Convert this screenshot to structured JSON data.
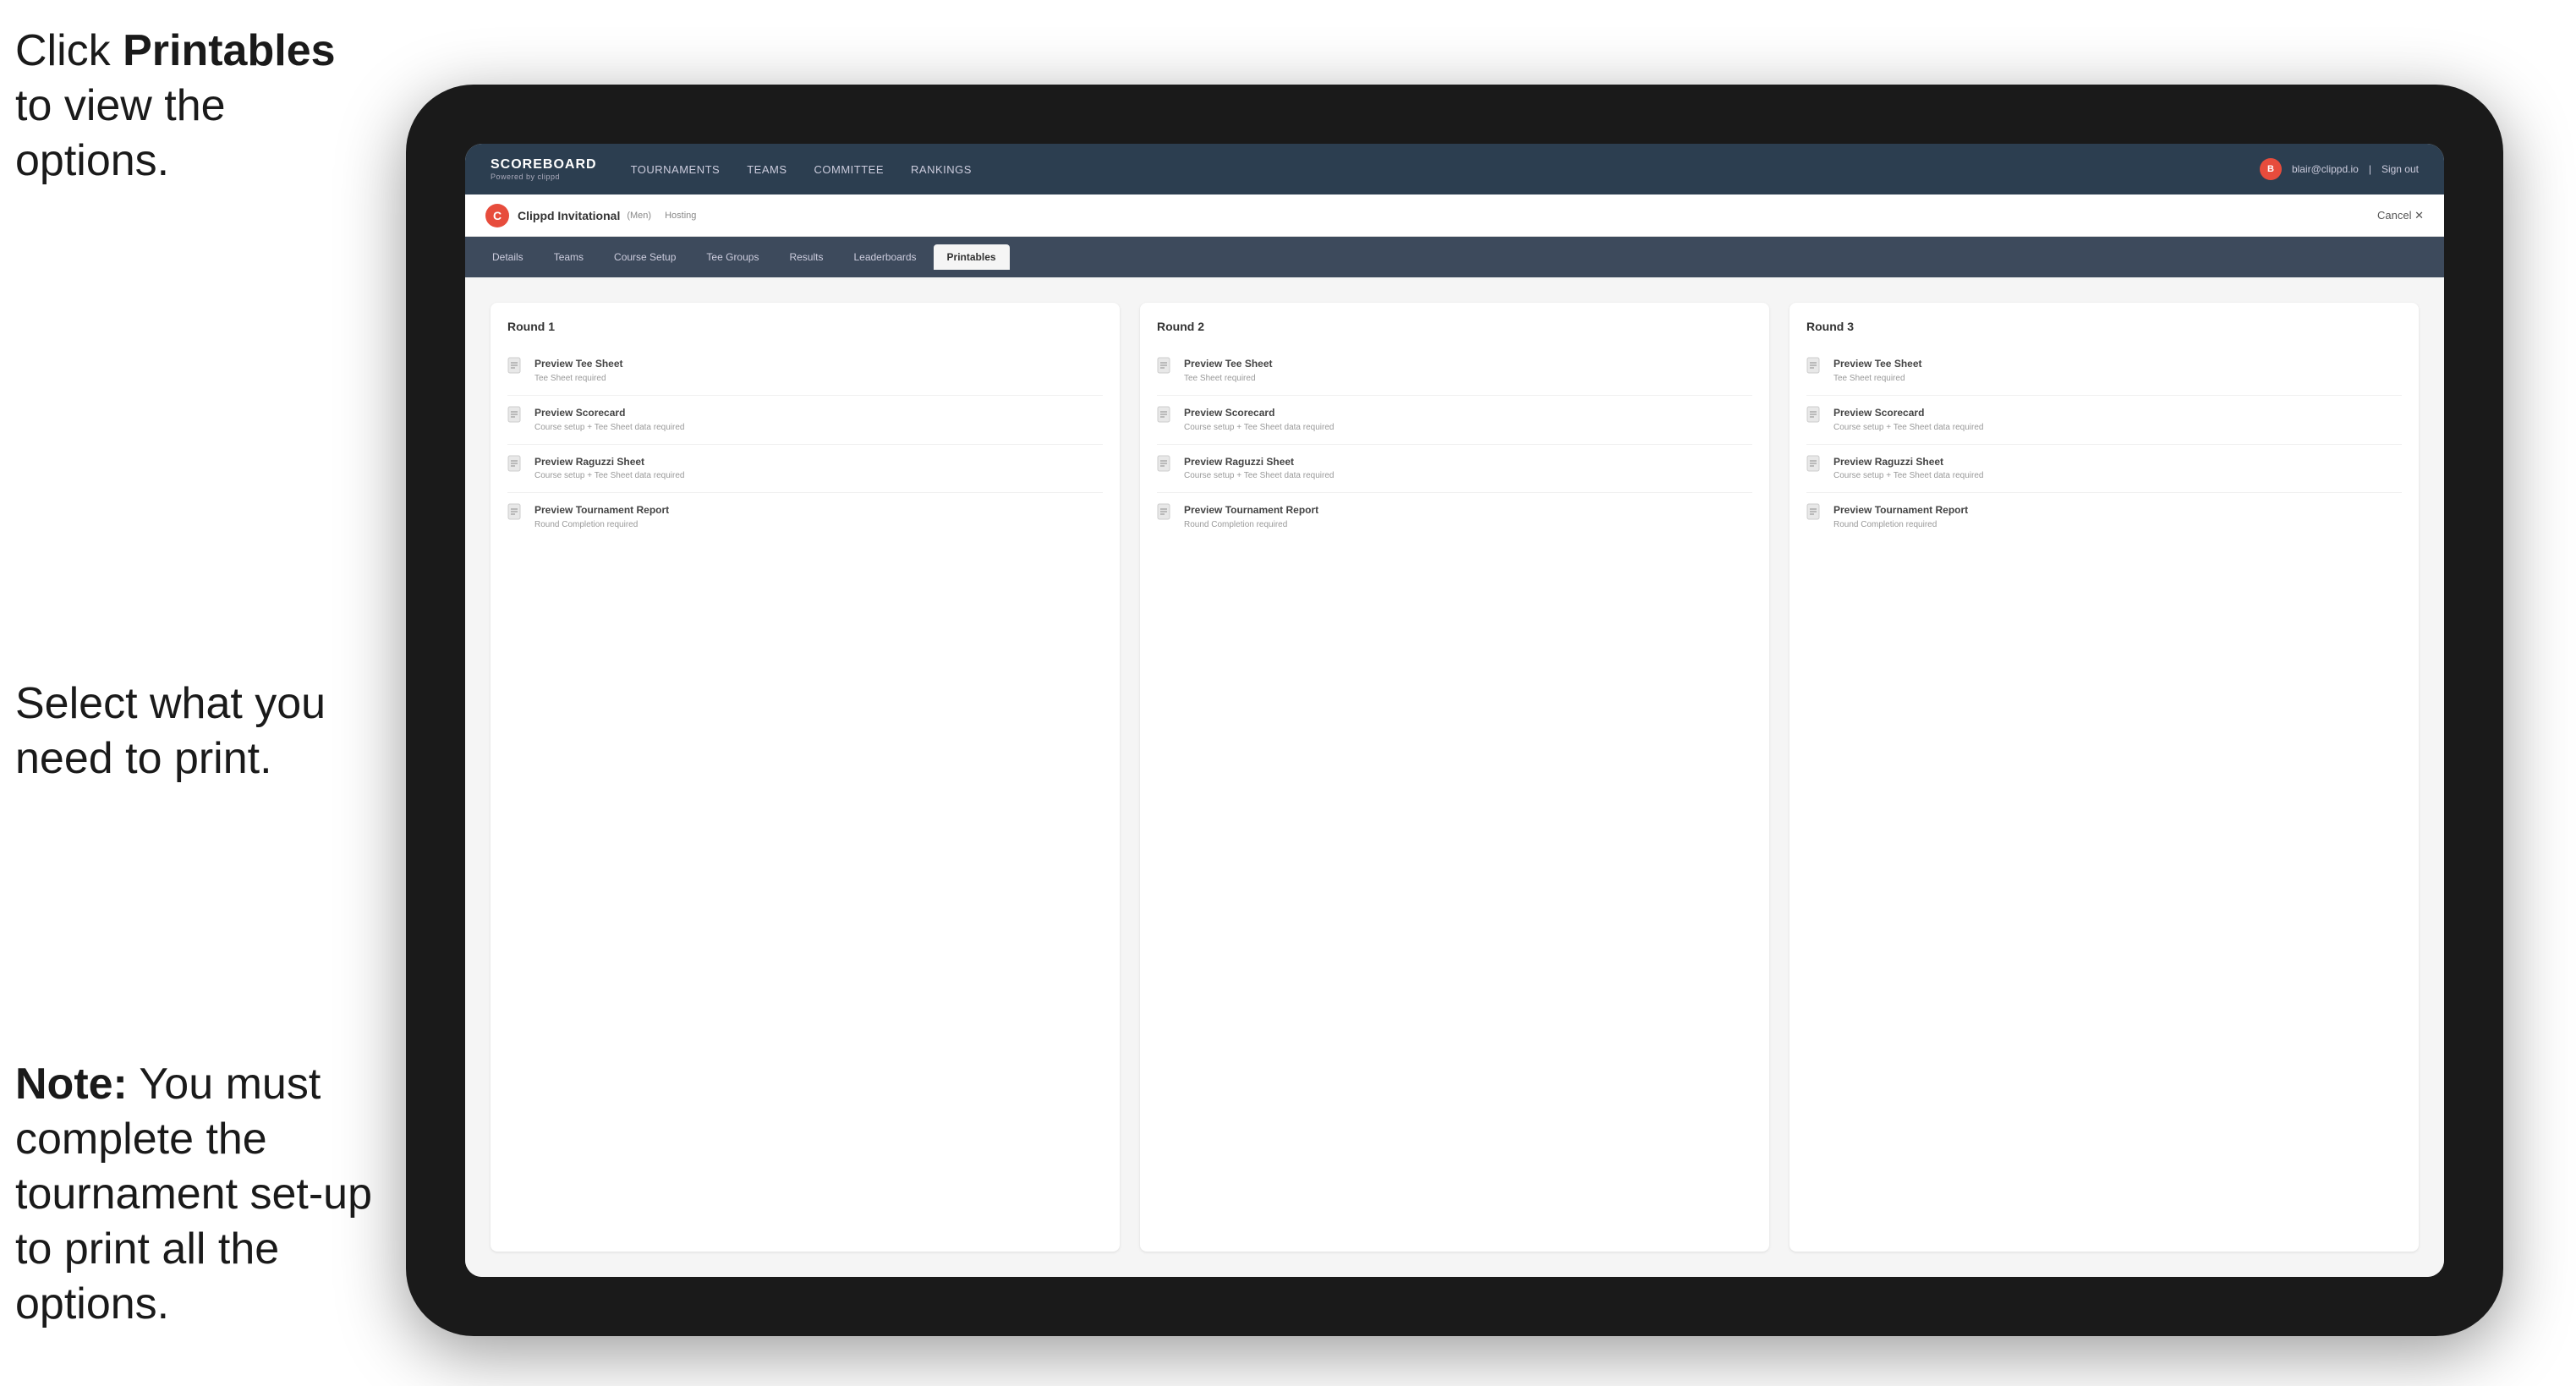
{
  "instructions": {
    "top_html": "Click <strong>Printables</strong> to view the options.",
    "middle": "Select what you need to print.",
    "bottom_html": "<strong>Note:</strong> You must complete the tournament set-up to print all the options."
  },
  "nav": {
    "logo_title": "SCOREBOARD",
    "logo_sub": "Powered by clippd",
    "items": [
      "TOURNAMENTS",
      "TEAMS",
      "COMMITTEE",
      "RANKINGS"
    ],
    "user_email": "blair@clippd.io",
    "sign_out": "Sign out"
  },
  "tournament": {
    "name": "Clippd Invitational",
    "badge": "(Men)",
    "status": "Hosting",
    "cancel": "Cancel ✕"
  },
  "tabs": [
    {
      "label": "Details",
      "active": false
    },
    {
      "label": "Teams",
      "active": false
    },
    {
      "label": "Course Setup",
      "active": false
    },
    {
      "label": "Tee Groups",
      "active": false
    },
    {
      "label": "Results",
      "active": false
    },
    {
      "label": "Leaderboards",
      "active": false
    },
    {
      "label": "Printables",
      "active": true
    }
  ],
  "rounds": [
    {
      "title": "Round 1",
      "items": [
        {
          "title": "Preview Tee Sheet",
          "subtitle": "Tee Sheet required"
        },
        {
          "title": "Preview Scorecard",
          "subtitle": "Course setup + Tee Sheet data required"
        },
        {
          "title": "Preview Raguzzi Sheet",
          "subtitle": "Course setup + Tee Sheet data required"
        },
        {
          "title": "Preview Tournament Report",
          "subtitle": "Round Completion required"
        }
      ]
    },
    {
      "title": "Round 2",
      "items": [
        {
          "title": "Preview Tee Sheet",
          "subtitle": "Tee Sheet required"
        },
        {
          "title": "Preview Scorecard",
          "subtitle": "Course setup + Tee Sheet data required"
        },
        {
          "title": "Preview Raguzzi Sheet",
          "subtitle": "Course setup + Tee Sheet data required"
        },
        {
          "title": "Preview Tournament Report",
          "subtitle": "Round Completion required"
        }
      ]
    },
    {
      "title": "Round 3",
      "items": [
        {
          "title": "Preview Tee Sheet",
          "subtitle": "Tee Sheet required"
        },
        {
          "title": "Preview Scorecard",
          "subtitle": "Course setup + Tee Sheet data required"
        },
        {
          "title": "Preview Raguzzi Sheet",
          "subtitle": "Course setup + Tee Sheet data required"
        },
        {
          "title": "Preview Tournament Report",
          "subtitle": "Round Completion required"
        }
      ]
    }
  ],
  "colors": {
    "accent": "#e74c3c",
    "nav_bg": "#2c3e50",
    "tab_bg": "#3d4a5c",
    "active_tab": "#f5f5f5"
  }
}
